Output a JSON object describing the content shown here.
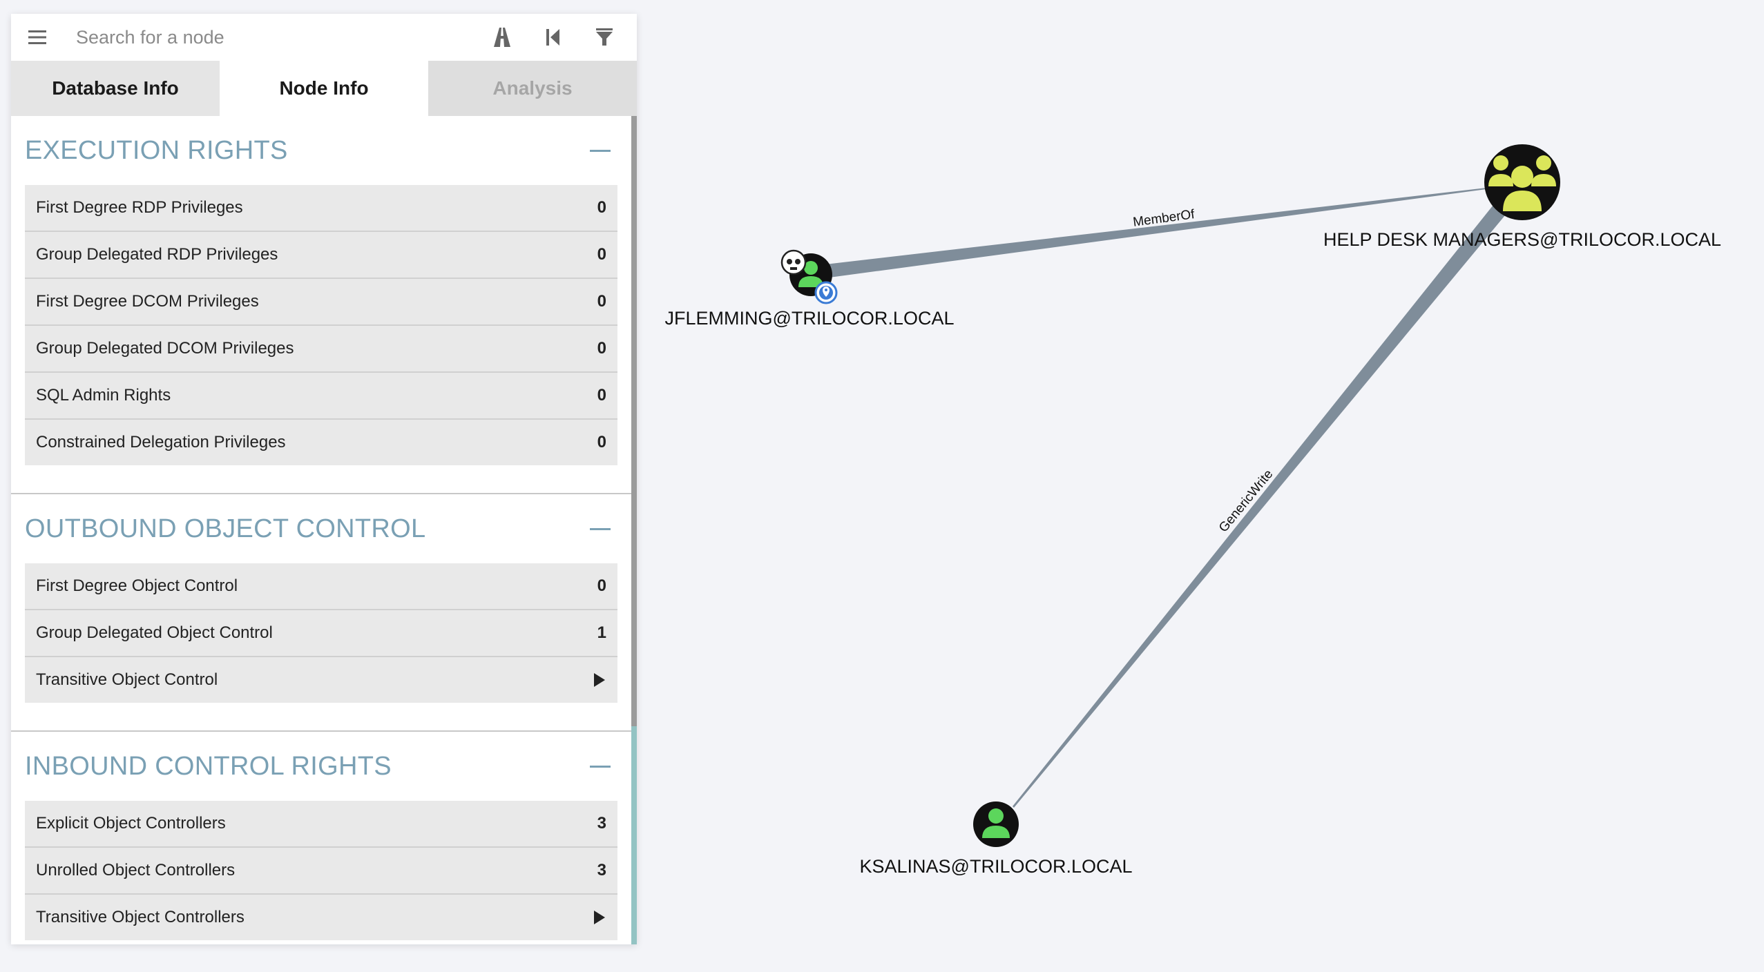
{
  "search": {
    "placeholder": "Search for a node"
  },
  "toolbar": {
    "icons": [
      "menu-icon",
      "pathfinding-icon",
      "back-icon",
      "filter-icon"
    ]
  },
  "tabs": [
    {
      "label": "Database Info",
      "state": "inactive"
    },
    {
      "label": "Node Info",
      "state": "active"
    },
    {
      "label": "Analysis",
      "state": "disabled"
    }
  ],
  "sections": {
    "execution": {
      "title": "EXECUTION RIGHTS",
      "rows": [
        {
          "label": "First Degree RDP Privileges",
          "value": "0"
        },
        {
          "label": "Group Delegated RDP Privileges",
          "value": "0"
        },
        {
          "label": "First Degree DCOM Privileges",
          "value": "0"
        },
        {
          "label": "Group Delegated DCOM Privileges",
          "value": "0"
        },
        {
          "label": "SQL Admin Rights",
          "value": "0"
        },
        {
          "label": "Constrained Delegation Privileges",
          "value": "0"
        }
      ]
    },
    "outbound": {
      "title": "OUTBOUND OBJECT CONTROL",
      "rows": [
        {
          "label": "First Degree Object Control",
          "value": "0"
        },
        {
          "label": "Group Delegated Object Control",
          "value": "1"
        },
        {
          "label": "Transitive Object Control",
          "value": ""
        }
      ]
    },
    "inbound": {
      "title": "INBOUND CONTROL RIGHTS",
      "rows": [
        {
          "label": "Explicit Object Controllers",
          "value": "3"
        },
        {
          "label": "Unrolled Object Controllers",
          "value": "3"
        },
        {
          "label": "Transitive Object Controllers",
          "value": ""
        }
      ]
    }
  },
  "graph": {
    "nodes": {
      "jflemming": {
        "label": "JFLEMMING@TRILOCOR.LOCAL",
        "type": "user",
        "owned": true,
        "icon_color": "#5cd65c"
      },
      "helpdesk": {
        "label": "HELP DESK MANAGERS@TRILOCOR.LOCAL",
        "type": "group",
        "icon_color": "#dbe65a"
      },
      "ksalinas": {
        "label": "KSALINAS@TRILOCOR.LOCAL",
        "type": "user",
        "icon_color": "#5cd65c"
      }
    },
    "edges": {
      "memberof": {
        "label": "MemberOf"
      },
      "genericwrite": {
        "label": "GenericWrite"
      }
    },
    "edge_color": "#7f8d9a"
  }
}
